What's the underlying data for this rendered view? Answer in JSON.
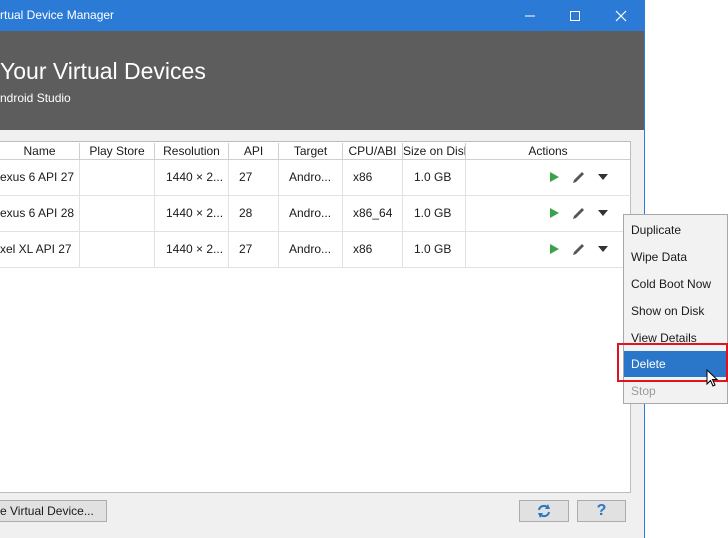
{
  "window": {
    "title": "rtual Device Manager"
  },
  "header": {
    "title": "Your Virtual Devices",
    "subtitle": "ndroid Studio"
  },
  "table": {
    "columns": [
      "Name",
      "Play Store",
      "Resolution",
      "API",
      "Target",
      "CPU/ABI",
      "Size on Disk",
      "Actions"
    ],
    "rows": [
      {
        "name": "exus 6 API 27",
        "play_store": "",
        "resolution": "1440 × 2...",
        "api": "27",
        "target": "Andro...",
        "cpu": "x86",
        "size": "1.0 GB"
      },
      {
        "name": "exus 6 API 28",
        "play_store": "",
        "resolution": "1440 × 2...",
        "api": "28",
        "target": "Andro...",
        "cpu": "x86_64",
        "size": "1.0 GB"
      },
      {
        "name": "xel XL API 27",
        "play_store": "",
        "resolution": "1440 × 2...",
        "api": "27",
        "target": "Andro...",
        "cpu": "x86",
        "size": "1.0 GB"
      }
    ]
  },
  "context_menu": {
    "items": [
      {
        "label": "Duplicate"
      },
      {
        "label": "Wipe Data"
      },
      {
        "label": "Cold Boot Now"
      },
      {
        "label": "Show on Disk"
      },
      {
        "label": "View Details"
      },
      {
        "label": "Delete",
        "state": "highlighted"
      },
      {
        "label": "Stop",
        "state": "disabled"
      }
    ]
  },
  "footer": {
    "create_label": "e Virtual Device...",
    "help_label": "?",
    "refresh_icon": "refresh-icon"
  },
  "colors": {
    "titlebar": "#2b7bd6",
    "header": "#5d5d5d",
    "run": "#3aa34a",
    "selection": "#2a77c9",
    "highlight_box": "#e0141e"
  }
}
